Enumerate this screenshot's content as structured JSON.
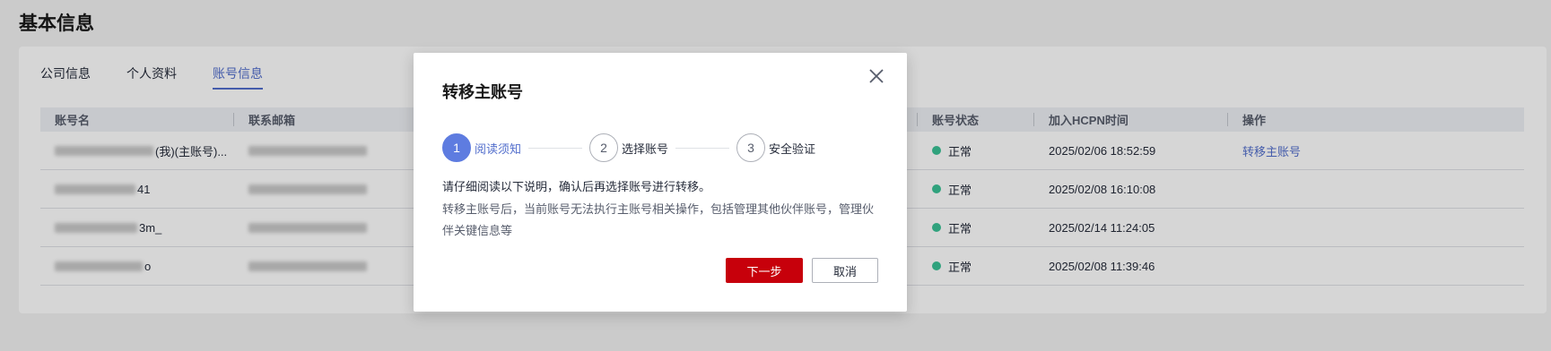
{
  "page": {
    "title": "基本信息"
  },
  "tabs": [
    {
      "label": "公司信息"
    },
    {
      "label": "个人资料"
    },
    {
      "label": "账号信息"
    }
  ],
  "table": {
    "columns": [
      "账号名",
      "联系邮箱",
      "",
      "账号状态",
      "加入HCPN时间",
      "操作"
    ],
    "rows": [
      {
        "name_suffix": "(我)(主账号)...",
        "status": "正常",
        "joined": "2025/02/06 18:52:59",
        "action": "转移主账号"
      },
      {
        "name_suffix": "41",
        "status": "正常",
        "joined": "2025/02/08 16:10:08",
        "action": ""
      },
      {
        "name_suffix": "3m_",
        "status": "正常",
        "joined": "2025/02/14 11:24:05",
        "action": ""
      },
      {
        "name_suffix": "o",
        "status": "正常",
        "joined": "2025/02/08 11:39:46",
        "action": ""
      }
    ]
  },
  "dialog": {
    "title": "转移主账号",
    "steps": [
      {
        "num": "1",
        "label": "阅读须知"
      },
      {
        "num": "2",
        "label": "选择账号"
      },
      {
        "num": "3",
        "label": "安全验证"
      }
    ],
    "notice_main": "请仔细阅读以下说明，确认后再选择账号进行转移。",
    "notice_sub": "转移主账号后，当前账号无法执行主账号相关操作，包括管理其他伙伴账号，管理伙伴关键信息等",
    "next_label": "下一步",
    "cancel_label": "取消"
  },
  "colors": {
    "accent": "#526ecc",
    "primary_button": "#c7000b",
    "status_ok": "#3ac295"
  }
}
